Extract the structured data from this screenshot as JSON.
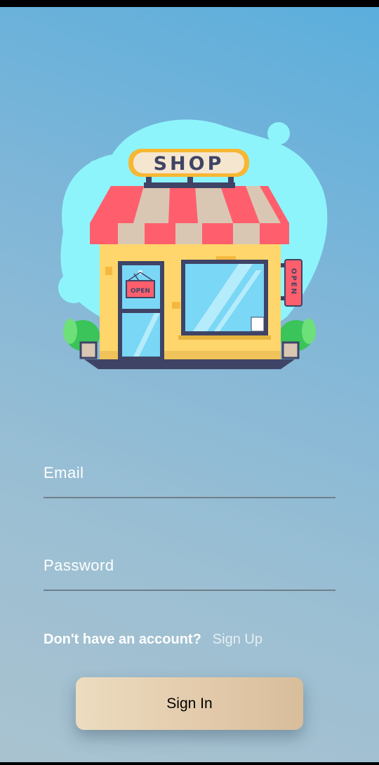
{
  "illustration": {
    "shop_sign": "SHOP",
    "door_sign": "OPEN",
    "hanging_sign": "OPEN"
  },
  "form": {
    "email_placeholder": "Email",
    "password_placeholder": "Password"
  },
  "signup": {
    "question": "Don't have an account?",
    "link": "Sign Up"
  },
  "signin_button": "Sign In",
  "colors": {
    "background_top": "#5aaedc",
    "background_bottom": "#a9c2cf",
    "button_gradient_start": "#ecdcc0",
    "button_gradient_end": "#d8bd9b",
    "blob": "#8ef4fb",
    "awning_red": "#ff5f6d",
    "awning_cream": "#d9c7b4",
    "shop_wall": "#ffd66b"
  }
}
